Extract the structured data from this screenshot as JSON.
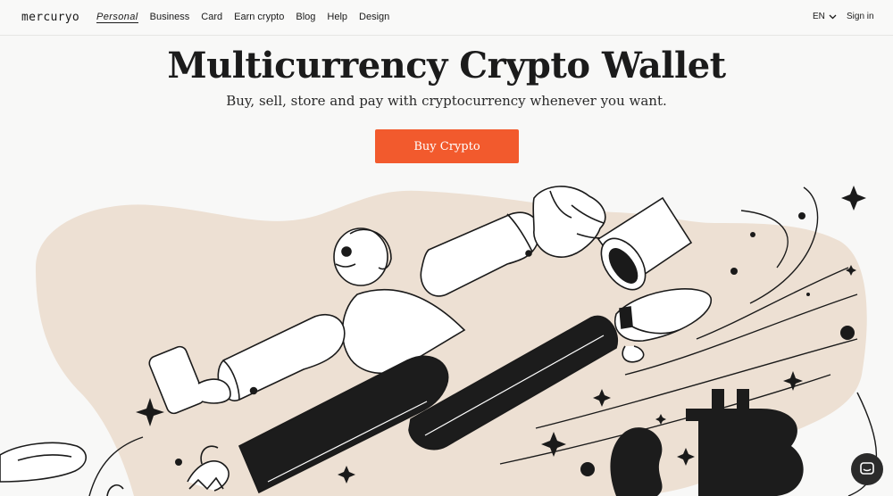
{
  "header": {
    "logo": "mercuryo",
    "nav": [
      {
        "label": "Personal",
        "active": true
      },
      {
        "label": "Business"
      },
      {
        "label": "Card"
      },
      {
        "label": "Earn crypto"
      },
      {
        "label": "Blog"
      },
      {
        "label": "Help"
      },
      {
        "label": "Design"
      }
    ],
    "language": "EN",
    "signin": "Sign in"
  },
  "hero": {
    "title": "Multicurrency Crypto Wallet",
    "subtitle": "Buy, sell, store and pay with cryptocurrency whenever you want.",
    "cta": "Buy Crypto"
  },
  "colors": {
    "accent": "#f25a2d",
    "blob": "#ede0d3",
    "ink": "#1a1a1a"
  },
  "icons": {
    "language_caret": "chevron-down-icon",
    "chat": "chat-icon"
  }
}
